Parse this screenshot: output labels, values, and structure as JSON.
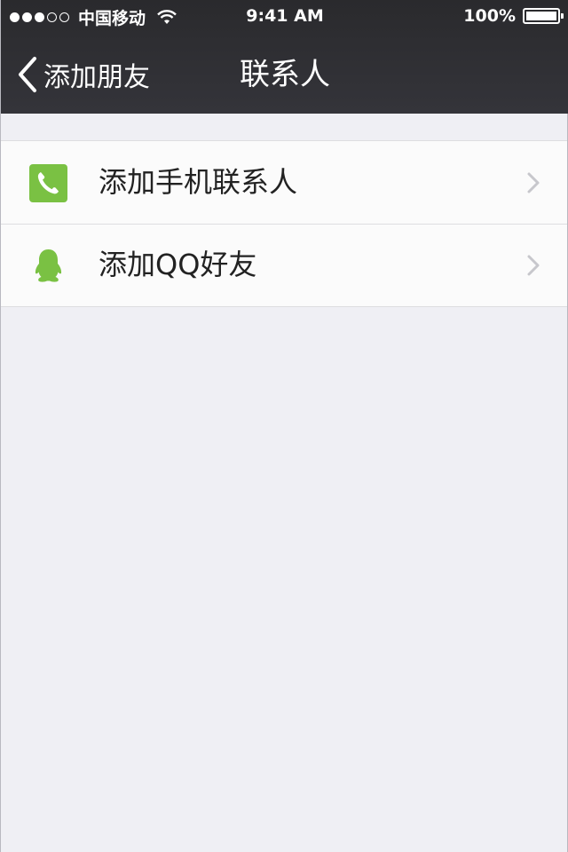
{
  "status_bar": {
    "carrier": "中国移动",
    "time": "9:41 AM",
    "battery": "100%",
    "icons": [
      "signal-dots-icon",
      "wifi-icon",
      "battery-icon"
    ]
  },
  "nav": {
    "back_label": "添加朋友",
    "title": "联系人"
  },
  "items": [
    {
      "label": "添加手机联系人",
      "icon": "phone-icon"
    },
    {
      "label": "添加QQ好友",
      "icon": "qq-penguin-icon"
    }
  ],
  "colors": {
    "accent": "#7ac143",
    "nav_background": "#2c2c30",
    "page_background": "#efeff4"
  }
}
